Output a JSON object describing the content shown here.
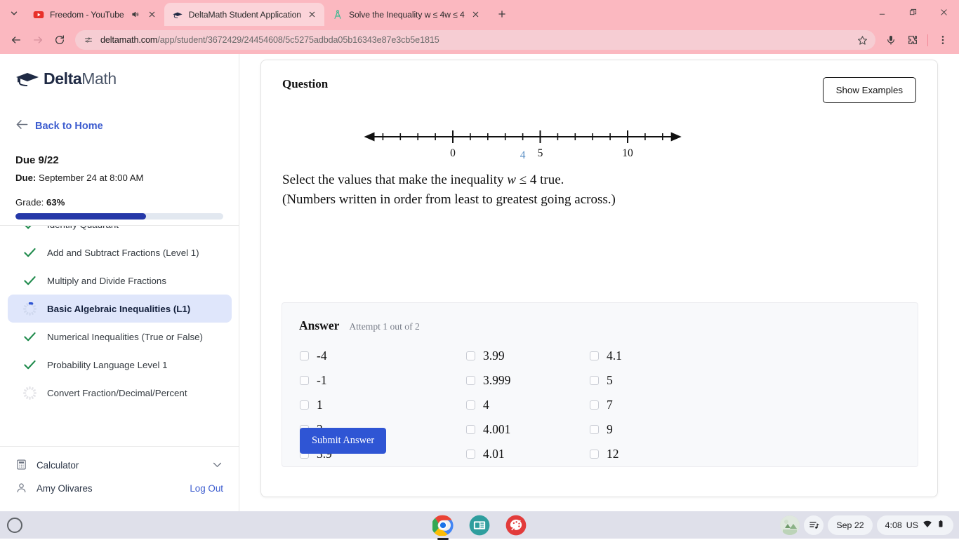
{
  "browser": {
    "tabs": [
      {
        "title": "Freedom - YouTube",
        "favicon": "youtube-icon",
        "active": false,
        "audio": true
      },
      {
        "title": "DeltaMath Student Application",
        "favicon": "deltamath-icon",
        "active": true,
        "audio": false
      },
      {
        "title": "Solve the Inequality w ≤ 4w ≤ 4",
        "favicon": "compass-icon",
        "active": false,
        "audio": false
      }
    ],
    "new_tab_label": "+",
    "url_bold": "deltamath.com",
    "url_rest": "/app/student/3672429/24454608/5c5275adbda05b16343e87e3cb5e1815",
    "toolbar_icons": [
      "back-icon",
      "forward-icon",
      "reload-icon",
      "site-info-icon",
      "bookmark-star-icon",
      "microphone-icon",
      "extensions-icon",
      "browser-menu-icon"
    ],
    "window_controls": [
      "minimize-icon",
      "restore-icon",
      "close-icon"
    ]
  },
  "sidebar": {
    "logo_bold": "Delta",
    "logo_light": "Math",
    "back_home": "Back to Home",
    "due_title": "Due 9/22",
    "due_label": "Due:",
    "due_value": " September 24 at 8:00 AM",
    "grade_label": "Grade: ",
    "grade_value": "63%",
    "progress_percent": 63,
    "topics": [
      {
        "label": "Identify Quadrant",
        "status": "complete"
      },
      {
        "label": "Add and Subtract Fractions (Level 1)",
        "status": "complete"
      },
      {
        "label": "Multiply and Divide Fractions",
        "status": "complete"
      },
      {
        "label": "Basic Algebraic Inequalities (L1)",
        "status": "in-progress",
        "active": true
      },
      {
        "label": "Numerical Inequalities (True or False)",
        "status": "complete"
      },
      {
        "label": "Probability Language Level 1",
        "status": "complete"
      },
      {
        "label": "Convert Fraction/Decimal/Percent",
        "status": "not-started"
      }
    ],
    "calculator_label": "Calculator",
    "user_name": "Amy Olivares",
    "logout_label": "Log Out"
  },
  "main": {
    "question_heading": "Question",
    "show_examples_label": "Show Examples",
    "prompt_line1_a": "Select the values that make the inequality ",
    "prompt_var": "w",
    "prompt_op": " ≤ ",
    "prompt_val": "4",
    "prompt_line1_b": " true.",
    "prompt_line2": "(Numbers written in order from least to greatest going across.)",
    "answer_label": "Answer",
    "attempt_label": "Attempt 1 out of 2",
    "submit_label": "Submit Answer",
    "choices": [
      {
        "label": "-4",
        "checked": false
      },
      {
        "label": "-1",
        "checked": false
      },
      {
        "label": "1",
        "checked": false
      },
      {
        "label": "3",
        "checked": false
      },
      {
        "label": "3.9",
        "checked": false
      },
      {
        "label": "3.99",
        "checked": false
      },
      {
        "label": "3.999",
        "checked": false
      },
      {
        "label": "4",
        "checked": false
      },
      {
        "label": "4.001",
        "checked": false
      },
      {
        "label": "4.01",
        "checked": false
      },
      {
        "label": "4.1",
        "checked": false
      },
      {
        "label": "5",
        "checked": false
      },
      {
        "label": "7",
        "checked": false
      },
      {
        "label": "9",
        "checked": false
      },
      {
        "label": "12",
        "checked": false
      }
    ]
  },
  "number_line": {
    "min": -5,
    "max": 13,
    "tick_step": 1,
    "major_ticks": [
      {
        "value": 0,
        "label": "0",
        "color": "#111111"
      },
      {
        "value": 5,
        "label": "5",
        "color": "#111111"
      },
      {
        "value": 10,
        "label": "10",
        "color": "#111111"
      }
    ],
    "highlight": {
      "value": 4,
      "label": "4",
      "color": "#5a8fc4"
    },
    "arrows_both_ends": true
  },
  "shelf": {
    "launcher": "launcher-icon",
    "apps": [
      "chrome-icon",
      "news-icon",
      "art-palette-icon"
    ],
    "tray": {
      "avatar": "user-avatar",
      "media_icon": "playlist-music-icon",
      "date": "Sep 22",
      "time": "4:08",
      "ime": "US",
      "wifi_icon": "wifi-icon",
      "battery_icon": "battery-icon"
    }
  },
  "colors": {
    "brand_blue": "#2f55d4",
    "progress_blue": "#2538a8",
    "active_item_bg": "#dfe6fb",
    "check_green": "#1e8a4b",
    "tab_strip": "#fbb8c0",
    "highlight_blue": "#5a8fc4"
  }
}
